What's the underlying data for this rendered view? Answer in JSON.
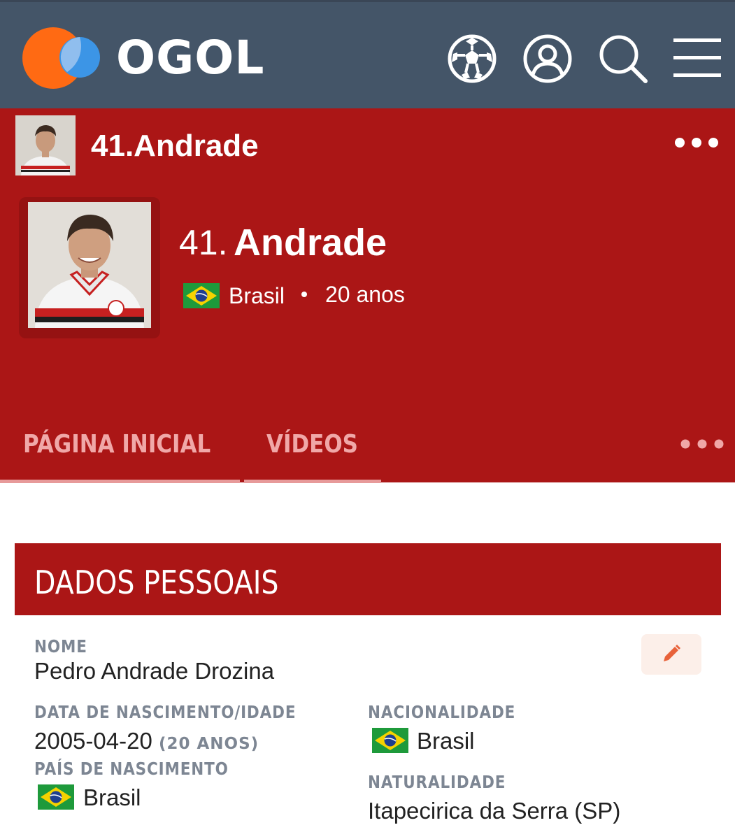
{
  "header": {
    "logo_text": "OGOL",
    "icons": [
      "soccer-ball-icon",
      "user-icon",
      "search-icon",
      "menu-icon"
    ]
  },
  "player": {
    "mini_title": "41.Andrade",
    "number": "41.",
    "name": "Andrade",
    "country": "Brasil",
    "age": "20 anos"
  },
  "tabs": [
    {
      "label": "PÁGINA INICIAL"
    },
    {
      "label": "VÍDEOS"
    }
  ],
  "personal": {
    "section_title": "DADOS PESSOAIS",
    "name_label": "NOME",
    "name_value": "Pedro Andrade Drozina",
    "birth_label": "DATA DE NASCIMENTO/IDADE",
    "birth_date": "2005-04-20",
    "birth_age": "(20 ANOS)",
    "nationality_label": "NACIONALIDADE",
    "nationality_value": "Brasil",
    "birth_country_label": "PAÍS DE NASCIMENTO",
    "birth_country_value": "Brasil",
    "hometown_label": "NATURALIDADE",
    "hometown_value": "Itapecirica da Serra (SP)"
  },
  "colors": {
    "topbar": "#445568",
    "team_red": "#ab1616",
    "label_gray": "#7d8693"
  }
}
